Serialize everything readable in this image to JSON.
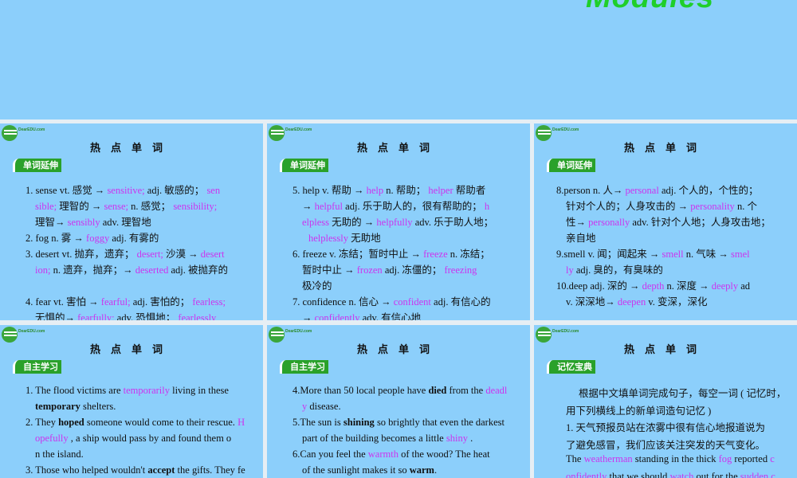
{
  "title": "Modules",
  "logo": "DearEDU.com",
  "panels": [
    {
      "heading": "热点单词",
      "tag": "单词延伸",
      "lines": [
        {
          "i": 0,
          "s": [
            [
              "1. sense vt. 感觉 → ",
              "n"
            ],
            [
              "sensitive;",
              "m"
            ],
            [
              " adj. 敏感的；  ",
              "n"
            ],
            [
              "sen",
              "m"
            ]
          ]
        },
        {
          "i": 1,
          "s": [
            [
              "sible;",
              "m"
            ],
            [
              " 理智的 → ",
              "n"
            ],
            [
              "sense;",
              "m"
            ],
            [
              " n. 感觉；  ",
              "n"
            ],
            [
              "sensibility;",
              "m"
            ]
          ]
        },
        {
          "i": 1,
          "s": [
            [
              "理智→  ",
              "n"
            ],
            [
              "sensibly",
              "m"
            ],
            [
              " adv. 理智地",
              "n"
            ]
          ]
        },
        {
          "i": 0,
          "s": [
            [
              "2. fog n. 雾 →  ",
              "n"
            ],
            [
              "foggy",
              "m"
            ],
            [
              " adj. 有雾的",
              "n"
            ]
          ]
        },
        {
          "i": 0,
          "s": [
            [
              "3. desert vt. 抛弃，遗弃； ",
              "n"
            ],
            [
              "desert;",
              "m"
            ],
            [
              " 沙漠 → ",
              "n"
            ],
            [
              "desert",
              "m"
            ]
          ]
        },
        {
          "i": 1,
          "s": [
            [
              "ion;",
              "m"
            ],
            [
              " n. 遗弃，抛弃；→  ",
              "n"
            ],
            [
              "deserted",
              "m"
            ],
            [
              " adj. 被抛弃的",
              "n"
            ]
          ]
        },
        {
          "i": 1,
          "s": []
        },
        {
          "i": 0,
          "s": [
            [
              "4. fear vt. 害怕 → ",
              "n"
            ],
            [
              "fearful;",
              "m"
            ],
            [
              " adj. 害怕的；  ",
              "n"
            ],
            [
              "fearless;",
              "m"
            ]
          ]
        },
        {
          "i": 1,
          "s": [
            [
              "无惧的→  ",
              "n"
            ],
            [
              "fearfully;",
              "m"
            ],
            [
              " adv. 恐惧地；  ",
              "n"
            ],
            [
              "fearlessly",
              "m"
            ]
          ]
        }
      ]
    },
    {
      "heading": "热点单词",
      "tag": "单词延伸",
      "lines": [
        {
          "i": 0,
          "s": [
            [
              "5. help v. 帮助 → ",
              "n"
            ],
            [
              "help",
              "m"
            ],
            [
              " n. 帮助；  ",
              "n"
            ],
            [
              "helper",
              "m"
            ],
            [
              " 帮助者",
              "n"
            ]
          ]
        },
        {
          "i": 1,
          "s": [
            [
              "→  ",
              "n"
            ],
            [
              "helpful",
              "m"
            ],
            [
              " adj. 乐于助人的，很有帮助的；  ",
              "n"
            ],
            [
              "h",
              "m"
            ]
          ]
        },
        {
          "i": 1,
          "s": [
            [
              "elpless",
              "m"
            ],
            [
              " 无助的 →  ",
              "n"
            ],
            [
              "helpfully",
              "m"
            ],
            [
              " adv. 乐于助人地；",
              "n"
            ]
          ]
        },
        {
          "i": 2,
          "s": [
            [
              "helplessly",
              "m"
            ],
            [
              " 无助地",
              "n"
            ]
          ]
        },
        {
          "i": 0,
          "s": [
            [
              "6. freeze v. 冻结；暂时中止 →  ",
              "n"
            ],
            [
              "freeze",
              "m"
            ],
            [
              " n. 冻结；",
              "n"
            ]
          ]
        },
        {
          "i": 1,
          "s": [
            [
              "暂时中止 →  ",
              "n"
            ],
            [
              "frozen",
              "m"
            ],
            [
              " adj. 冻僵的；  ",
              "n"
            ],
            [
              "freezing",
              "m"
            ]
          ]
        },
        {
          "i": 1,
          "s": [
            [
              "极冷的",
              "n"
            ]
          ]
        },
        {
          "i": 0,
          "s": [
            [
              "7. confidence n. 信心 →  ",
              "n"
            ],
            [
              "confident",
              "m"
            ],
            [
              " adj. 有信心的",
              "n"
            ]
          ]
        },
        {
          "i": 1,
          "s": [
            [
              "→  ",
              "n"
            ],
            [
              "confidently",
              "m"
            ],
            [
              " adv. 有信心地",
              "n"
            ]
          ]
        }
      ]
    },
    {
      "heading": "热点单词",
      "tag": "单词延伸",
      "lines": [
        {
          "i": 0,
          "s": [
            [
              "8.person n. 人→  ",
              "n"
            ],
            [
              "personal",
              "m"
            ],
            [
              " adj. 个人的，个性的；",
              "n"
            ]
          ]
        },
        {
          "i": 1,
          "s": [
            [
              "针对个人的；人身攻击的 →  ",
              "n"
            ],
            [
              "personality",
              "m"
            ],
            [
              " n. 个",
              "n"
            ]
          ]
        },
        {
          "i": 1,
          "s": [
            [
              "性→  ",
              "n"
            ],
            [
              "personally",
              "m"
            ],
            [
              " adv. 针对个人地；人身攻击地；",
              "n"
            ]
          ]
        },
        {
          "i": 1,
          "s": [
            [
              "亲自地",
              "n"
            ]
          ]
        },
        {
          "i": 0,
          "s": [
            [
              "9.smell v. 闻；闻起来 →  ",
              "n"
            ],
            [
              "smell",
              "m"
            ],
            [
              " n. 气味 →  ",
              "n"
            ],
            [
              "smel",
              "m"
            ]
          ]
        },
        {
          "i": 1,
          "s": [
            [
              "ly",
              "m"
            ],
            [
              " adj. 臭的，有臭味的",
              "n"
            ]
          ]
        },
        {
          "i": 0,
          "s": [
            [
              "10.deep adj. 深的 →  ",
              "n"
            ],
            [
              "depth",
              "m"
            ],
            [
              " n. 深度 →  ",
              "n"
            ],
            [
              "deeply",
              "m"
            ],
            [
              " ad",
              "n"
            ]
          ]
        },
        {
          "i": 1,
          "s": [
            [
              "v. 深深地→   ",
              "n"
            ],
            [
              "deepen",
              "m"
            ],
            [
              " v. 变深，深化",
              "n"
            ]
          ]
        }
      ]
    },
    {
      "heading": "热点单词",
      "tag": "自主学习",
      "lines": [
        {
          "i": 0,
          "s": [
            [
              "1. The flood victims are ",
              "n"
            ],
            [
              "temporarily",
              "m"
            ],
            [
              "      living in these",
              "n"
            ]
          ]
        },
        {
          "i": 1,
          "s": [
            [
              "temporary",
              "b"
            ],
            [
              " shelters.",
              "n"
            ]
          ]
        },
        {
          "i": 0,
          "s": [
            [
              "2. They ",
              "n"
            ],
            [
              "hoped",
              "b"
            ],
            [
              " someone would come to their rescue. ",
              "n"
            ],
            [
              "H",
              "m"
            ]
          ]
        },
        {
          "i": 1,
          "s": [
            [
              "opefully",
              "m"
            ],
            [
              " ,     a ship would pass by and found them o",
              "n"
            ]
          ]
        },
        {
          "i": 1,
          "s": [
            [
              "n the island.",
              "n"
            ]
          ]
        },
        {
          "i": 0,
          "s": [
            [
              "3. Those who helped wouldn't ",
              "n"
            ],
            [
              "accept",
              "b"
            ],
            [
              " the gifts. They fe",
              "n"
            ]
          ]
        }
      ]
    },
    {
      "heading": "热点单词",
      "tag": "自主学习",
      "lines": [
        {
          "i": 0,
          "s": [
            [
              "4.More than 50 local people have ",
              "n"
            ],
            [
              "died",
              "b"
            ],
            [
              " from the ",
              "n"
            ],
            [
              "deadl",
              "m"
            ]
          ]
        },
        {
          "i": 1,
          "s": [
            [
              "y",
              "m"
            ],
            [
              "      disease.",
              "n"
            ]
          ]
        },
        {
          "i": 0,
          "s": [
            [
              "5.The sun is ",
              "n"
            ],
            [
              "shining",
              "b"
            ],
            [
              " so brightly that even the darkest",
              "n"
            ]
          ]
        },
        {
          "i": 1,
          "s": [
            [
              "part of the building becomes a little ",
              "n"
            ],
            [
              "shiny",
              "m"
            ],
            [
              "      .",
              "n"
            ]
          ]
        },
        {
          "i": 0,
          "s": [
            [
              "6.Can you feel the ",
              "n"
            ],
            [
              "warmth",
              "m"
            ],
            [
              "      of the wood? The heat",
              "n"
            ]
          ]
        },
        {
          "i": 1,
          "s": [
            [
              "of the sunlight makes it so ",
              "n"
            ],
            [
              "warm",
              "b"
            ],
            [
              ".",
              "n"
            ]
          ]
        }
      ]
    },
    {
      "heading": "热点单词",
      "tag": "记忆宝典",
      "lines": [
        {
          "i": 3,
          "s": [
            [
              "根据中文填单词完成句子，每空一词 ( 记忆时，",
              "n"
            ]
          ]
        },
        {
          "i": 1,
          "s": [
            [
              "用下列横线上的新单词造句记忆 )",
              "n"
            ]
          ]
        },
        {
          "i": 1,
          "s": [
            [
              " 1. 天气预报员站在浓雾中很有信心地报道说为",
              "n"
            ]
          ]
        },
        {
          "i": 1,
          "s": [
            [
              "了避免感冒，我们应该关注突发的天气变化。",
              "n"
            ]
          ]
        },
        {
          "i": 1,
          "s": [
            [
              "The ",
              "n"
            ],
            [
              "weatherman",
              "m"
            ],
            [
              " standing in the thick ",
              "n"
            ],
            [
              "fog",
              "m"
            ],
            [
              " reported ",
              "n"
            ],
            [
              "c",
              "m"
            ]
          ]
        },
        {
          "i": 1,
          "s": [
            [
              "onfidently",
              "m"
            ],
            [
              " that we should ",
              "n"
            ],
            [
              "watch",
              "m"
            ],
            [
              " out for the ",
              "n"
            ],
            [
              "sudden c",
              "m"
            ]
          ]
        }
      ]
    }
  ]
}
